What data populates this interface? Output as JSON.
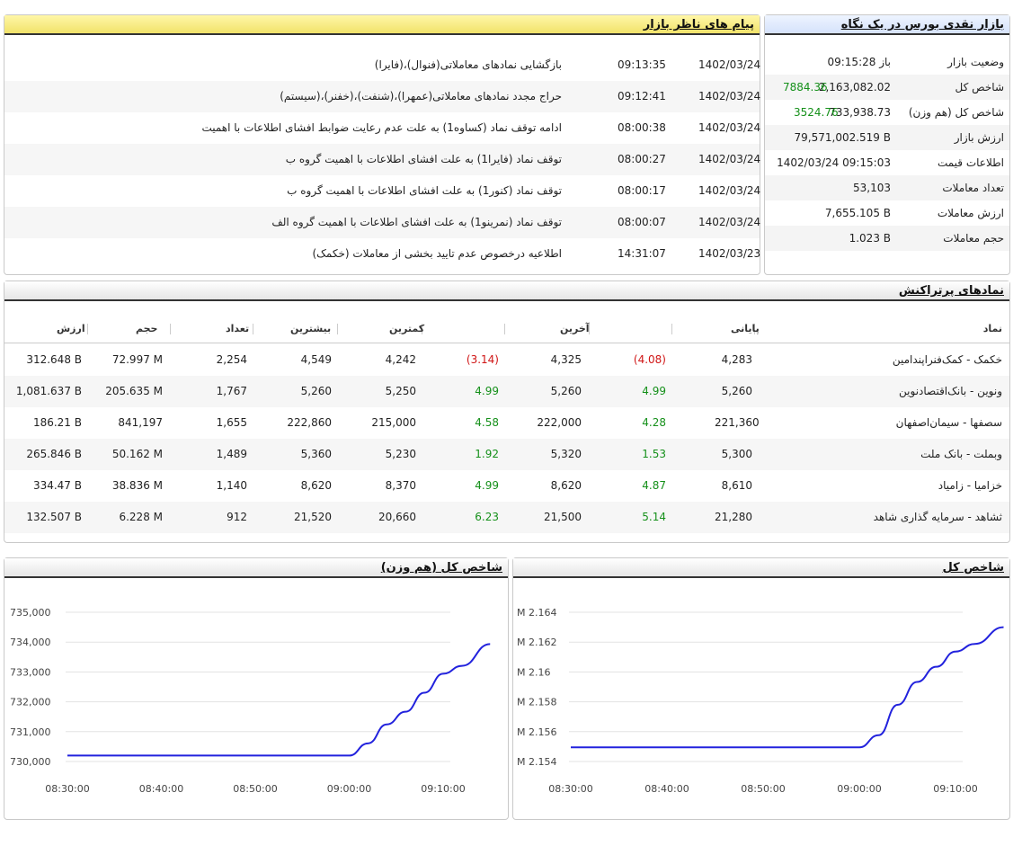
{
  "messages": {
    "title": "پیام های ناظر بازار",
    "rows": [
      {
        "date": "1402/03/24",
        "time": "09:13:35",
        "text": "بازگشایی نمادهای معاملاتی(فنوال)،(فایرا)"
      },
      {
        "date": "1402/03/24",
        "time": "09:12:41",
        "text": "حراج مجدد نمادهای معاملاتی(عمهرا)،(شنفت)،(خفنر)،(سیستم)"
      },
      {
        "date": "1402/03/24",
        "time": "08:00:38",
        "text": "ادامه توقف نماد (کساوه1) به علت عدم رعایت ضوابط افشای اطلاعات با اهمیت"
      },
      {
        "date": "1402/03/24",
        "time": "08:00:27",
        "text": "توقف نماد (فایرا1) به علت افشای اطلاعات با اهمیت گروه ب"
      },
      {
        "date": "1402/03/24",
        "time": "08:00:17",
        "text": "توقف نماد (کنور1) به علت افشای اطلاعات با اهمیت گروه ب"
      },
      {
        "date": "1402/03/24",
        "time": "08:00:07",
        "text": "توقف نماد (نمرینو1) به علت افشای اطلاعات با اهمیت گروه الف"
      },
      {
        "date": "1402/03/23",
        "time": "14:31:07",
        "text": "اطلاعیه درخصوص عدم تایید بخشی از معاملات (خکمک)"
      }
    ]
  },
  "summary": {
    "title": "بازار نقدی بورس در یک نگاه",
    "rows": [
      {
        "label": "وضعیت بازار",
        "value": "باز 09:15:28",
        "change": ""
      },
      {
        "label": "شاخص کل",
        "value": "2,163,082.02",
        "change": "7884.36"
      },
      {
        "label": "شاخص کل (هم وزن)",
        "value": "733,938.73",
        "change": "3524.76"
      },
      {
        "label": "ارزش بازار",
        "value": "79,571,002.519 B",
        "change": ""
      },
      {
        "label": "اطلاعات قیمت",
        "value": "1402/03/24 09:15:03",
        "change": ""
      },
      {
        "label": "تعداد معاملات",
        "value": "53,103",
        "change": ""
      },
      {
        "label": "ارزش معاملات",
        "value": "7,655.105 B",
        "change": ""
      },
      {
        "label": "حجم معاملات",
        "value": "1.023 B",
        "change": ""
      }
    ]
  },
  "top_symbols": {
    "title": "نمادهای پرتراکنش",
    "headers": {
      "symbol": "نماد",
      "close": "پایانی",
      "last": "آخرین",
      "min": "کمترین",
      "max": "بیشترین",
      "count": "تعداد",
      "volume": "حجم",
      "value": "ارزش"
    },
    "rows": [
      {
        "symbol": "خکمک - کمک‌فنراپندامین",
        "close": "4,283",
        "close_pct": "(4.08)",
        "close_dir": "neg",
        "last": "4,325",
        "last_pct": "(3.14)",
        "last_dir": "neg",
        "min": "4,242",
        "max": "4,549",
        "count": "2,254",
        "volume": "72.997 M",
        "value": "312.648 B"
      },
      {
        "symbol": "ونوین - بانک‌اقتصادنوین",
        "close": "5,260",
        "close_pct": "4.99",
        "close_dir": "pos",
        "last": "5,260",
        "last_pct": "4.99",
        "last_dir": "pos",
        "min": "5,250",
        "max": "5,260",
        "count": "1,767",
        "volume": "205.635 M",
        "value": "1,081.637 B"
      },
      {
        "symbol": "سصفها - سیمان‌اصفهان",
        "close": "221,360",
        "close_pct": "4.28",
        "close_dir": "pos",
        "last": "222,000",
        "last_pct": "4.58",
        "last_dir": "pos",
        "min": "215,000",
        "max": "222,860",
        "count": "1,655",
        "volume": "841,197",
        "value": "186.21 B"
      },
      {
        "symbol": "وبملت - بانک ملت",
        "close": "5,300",
        "close_pct": "1.53",
        "close_dir": "pos",
        "last": "5,320",
        "last_pct": "1.92",
        "last_dir": "pos",
        "min": "5,230",
        "max": "5,360",
        "count": "1,489",
        "volume": "50.162 M",
        "value": "265.846 B"
      },
      {
        "symbol": "خزامیا - زامیاد",
        "close": "8,610",
        "close_pct": "4.87",
        "close_dir": "pos",
        "last": "8,620",
        "last_pct": "4.99",
        "last_dir": "pos",
        "min": "8,370",
        "max": "8,620",
        "count": "1,140",
        "volume": "38.836 M",
        "value": "334.47 B"
      },
      {
        "symbol": "ثشاهد - سرمایه گذاری شاهد",
        "close": "21,280",
        "close_pct": "5.14",
        "close_dir": "pos",
        "last": "21,500",
        "last_pct": "6.23",
        "last_dir": "pos",
        "min": "20,660",
        "max": "21,520",
        "count": "912",
        "volume": "6.228 M",
        "value": "132.507 B"
      }
    ]
  },
  "colors": {
    "line": "#2222dd",
    "positive": "#15901a",
    "negative": "#d01515",
    "grid": "#e3e3e3"
  },
  "chart_data": [
    {
      "type": "line",
      "title": "شاخص کل (هم وزن)",
      "x": [
        "08:30:00",
        "08:35:00",
        "08:40:00",
        "08:45:00",
        "08:50:00",
        "08:55:00",
        "09:00:00",
        "09:02:00",
        "09:04:00",
        "09:06:00",
        "09:08:00",
        "09:10:00",
        "09:12:00",
        "09:15:00"
      ],
      "y": [
        730414,
        730414,
        730414,
        730414,
        730414,
        730414,
        730414,
        730800,
        731400,
        731800,
        732400,
        733000,
        733250,
        733939
      ],
      "x_ticks": [
        "08:30:00",
        "08:40:00",
        "08:50:00",
        "09:00:00",
        "09:10:00"
      ],
      "y_ticks": [
        "730,000",
        "731,000",
        "732,000",
        "733,000",
        "734,000",
        "735,000"
      ],
      "ylim": [
        730000,
        735000
      ]
    },
    {
      "type": "line",
      "title": "شاخص کل",
      "x": [
        "08:30:00",
        "08:35:00",
        "08:40:00",
        "08:45:00",
        "08:50:00",
        "08:55:00",
        "09:00:00",
        "09:02:00",
        "09:04:00",
        "09:06:00",
        "09:08:00",
        "09:10:00",
        "09:12:00",
        "09:15:00"
      ],
      "y": [
        2.1552,
        2.1552,
        2.1552,
        2.1552,
        2.1552,
        2.1552,
        2.1552,
        2.156,
        2.158,
        2.1595,
        2.1605,
        2.1615,
        2.162,
        2.1631
      ],
      "x_ticks": [
        "08:30:00",
        "08:40:00",
        "08:50:00",
        "09:00:00",
        "09:10:00"
      ],
      "y_ticks": [
        "M 2.154",
        "M 2.156",
        "M 2.158",
        "M 2.16",
        "M 2.162",
        "M 2.164"
      ],
      "ylim": [
        2.1538,
        2.1642
      ]
    }
  ]
}
